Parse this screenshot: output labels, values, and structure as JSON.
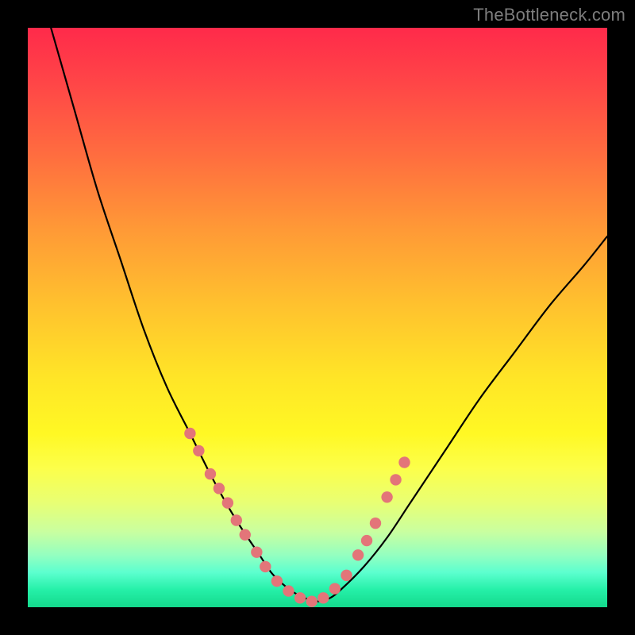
{
  "watermark": "TheBottleneck.com",
  "chart_data": {
    "type": "line",
    "title": "",
    "xlabel": "",
    "ylabel": "",
    "xlim": [
      0,
      100
    ],
    "ylim": [
      0,
      100
    ],
    "series": [
      {
        "name": "bottleneck-curve",
        "x": [
          4,
          8,
          12,
          16,
          20,
          24,
          28,
          32,
          36,
          40,
          42,
          44,
          46,
          48,
          50,
          52,
          54,
          58,
          62,
          66,
          72,
          78,
          84,
          90,
          96,
          100
        ],
        "values": [
          100,
          86,
          72,
          60,
          48,
          38,
          30,
          22,
          15,
          9,
          6,
          4,
          2.5,
          1.5,
          1,
          1.5,
          3,
          7,
          12,
          18,
          27,
          36,
          44,
          52,
          59,
          64
        ]
      }
    ],
    "markers": {
      "name": "highlight-dots",
      "color": "#e37579",
      "x": [
        28.0,
        29.5,
        31.5,
        33.0,
        34.5,
        36.0,
        37.5,
        39.5,
        41.0,
        43.0,
        45.0,
        47.0,
        49.0,
        51.0,
        53.0,
        55.0,
        57.0,
        58.5,
        60.0,
        62.0,
        63.5,
        65.0
      ],
      "values": [
        30.0,
        27.0,
        23.0,
        20.5,
        18.0,
        15.0,
        12.5,
        9.5,
        7.0,
        4.5,
        2.8,
        1.6,
        1.0,
        1.6,
        3.2,
        5.5,
        9.0,
        11.5,
        14.5,
        19.0,
        22.0,
        25.0
      ]
    }
  }
}
